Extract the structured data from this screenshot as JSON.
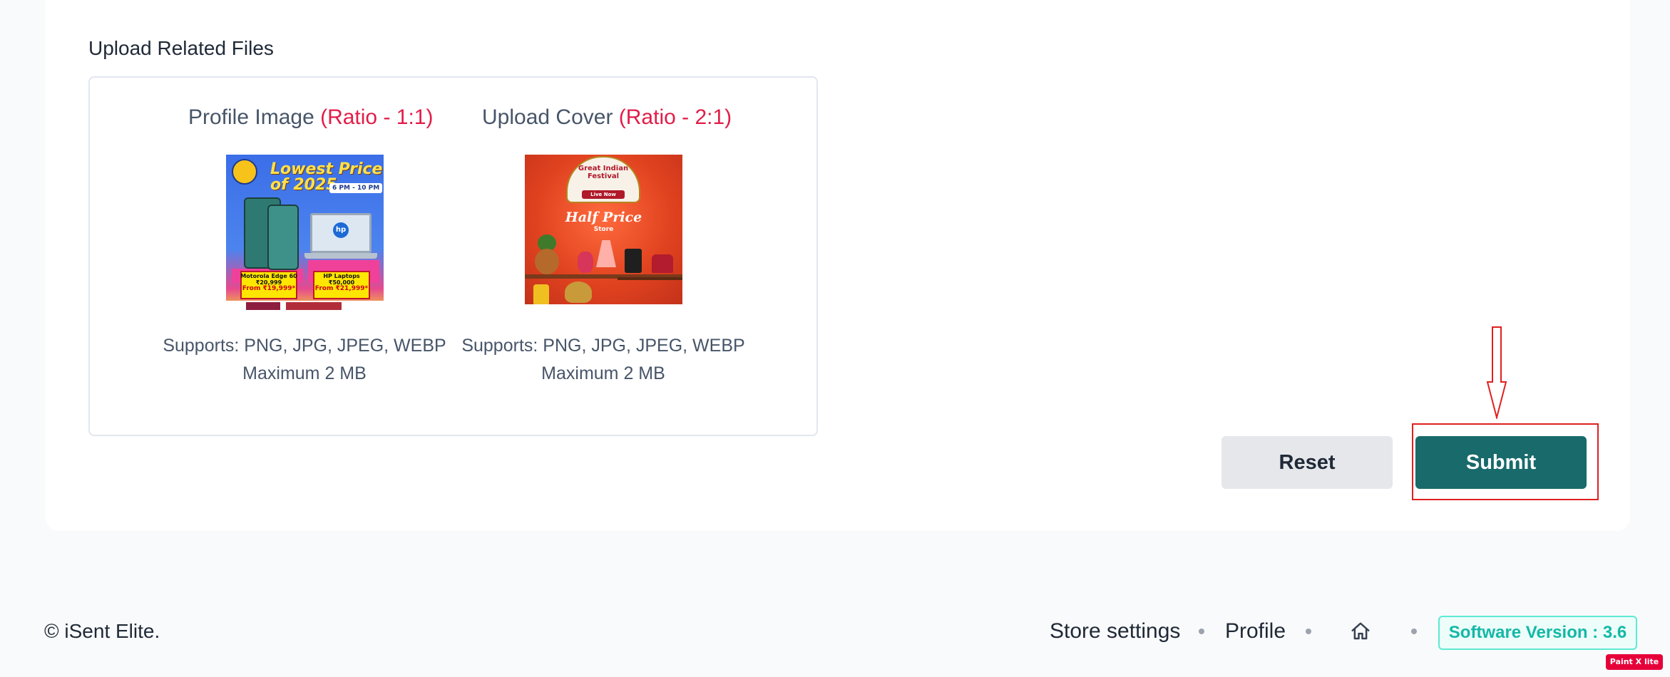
{
  "section": {
    "title": "Upload Related Files"
  },
  "uploads": [
    {
      "label": "Profile Image",
      "ratio": "(Ratio - 1:1)",
      "supports": "Supports: PNG, JPG, JPEG, WEBP",
      "max_size": "Maximum 2 MB",
      "preview": {
        "headline": "Lowest Price of 2025",
        "time": "6 PM - 10 PM",
        "left_product": "Motorola Edge 60",
        "left_mrp": "₹20,999",
        "left_price": "From ₹19,999*",
        "right_product": "HP Laptops",
        "right_mrp": "₹50,000",
        "right_price": "From ₹21,999*",
        "laptop_logo": "hp"
      }
    },
    {
      "label": "Upload Cover",
      "ratio": "(Ratio - 2:1)",
      "supports": "Supports: PNG, JPG, JPEG, WEBP",
      "max_size": "Maximum 2 MB",
      "preview": {
        "festival": "Great Indian Festival",
        "live": "Live Now",
        "headline": "Half Price",
        "subline": "Store"
      }
    }
  ],
  "buttons": {
    "reset": "Reset",
    "submit": "Submit"
  },
  "footer": {
    "copyright": "© iSent Elite.",
    "store_settings": "Store settings",
    "profile": "Profile",
    "home_icon": "home-icon",
    "version": "Software Version : 3.6"
  },
  "watermark": "Paint X lite",
  "colors": {
    "accent": "#186a6b",
    "ratio_text": "#e11d48",
    "annotation_red": "#e02020",
    "version_text": "#14b8a6"
  }
}
